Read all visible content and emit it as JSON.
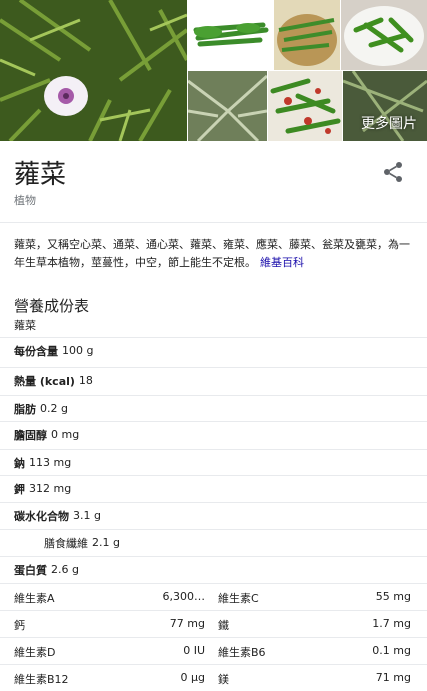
{
  "gallery": {
    "more_label": "更多圖片"
  },
  "header": {
    "title": "蕹菜",
    "subtitle": "植物"
  },
  "description": {
    "text": "蕹菜，又稱空心菜、通菜、通心菜、蕹菜、雍菜、應菜、藤菜、瓮菜及甕菜，為一年生草本植物，莖蔓性，中空，節上能生不定根。",
    "source_link": "維基百科"
  },
  "nutrition": {
    "title": "營養成份表",
    "subtitle": "蕹菜",
    "rows": [
      {
        "label": "每份含量",
        "value": "100 g"
      },
      {
        "label": "熱量 (kcal)",
        "value": "18"
      },
      {
        "label": "脂肪",
        "value": "0.2 g"
      },
      {
        "label": "膽固醇",
        "value": "0 mg"
      },
      {
        "label": "鈉",
        "value": "113 mg"
      },
      {
        "label": "鉀",
        "value": "312 mg"
      },
      {
        "label": "碳水化合物",
        "value": "3.1 g"
      },
      {
        "label": "膳食纖維",
        "value": "2.1 g"
      },
      {
        "label": "蛋白質",
        "value": "2.6 g"
      }
    ],
    "pairs": [
      {
        "l1": "維生素A",
        "v1": "6,300…",
        "l2": "維生素C",
        "v2": "55 mg"
      },
      {
        "l1": "鈣",
        "v1": "77 mg",
        "l2": "鐵",
        "v2": "1.7 mg"
      },
      {
        "l1": "維生素D",
        "v1": "0 IU",
        "l2": "維生素B6",
        "v2": "0.1 mg"
      },
      {
        "l1": "維生素B12",
        "v1": "0 µg",
        "l2": "鎂",
        "v2": "71 mg"
      }
    ]
  }
}
